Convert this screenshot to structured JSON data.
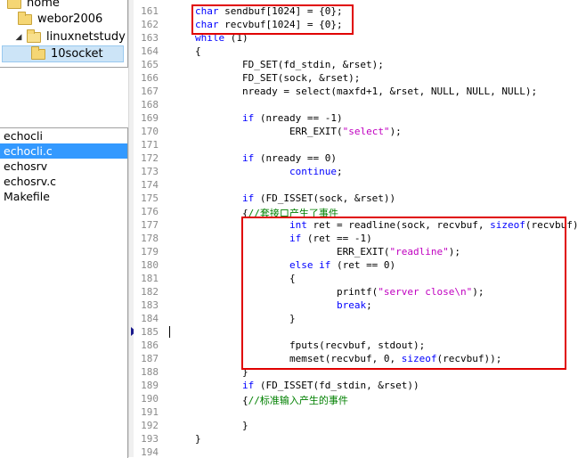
{
  "tree": {
    "items": [
      {
        "label": "home",
        "expander": "",
        "open": false
      },
      {
        "label": "webor2006",
        "expander": "",
        "open": false
      },
      {
        "label": "linuxnetstudy",
        "expander": "◢",
        "open": true
      },
      {
        "label": "10socket",
        "expander": "",
        "open": false
      }
    ]
  },
  "files": [
    "echocli",
    "echocli.c",
    "echosrv",
    "echosrv.c",
    "Makefile"
  ],
  "code_lines": [
    {
      "n": "161",
      "t": [
        [
          "char",
          "kw"
        ],
        [
          " sendbuf[1024] = {0};",
          ""
        ]
      ]
    },
    {
      "n": "162",
      "t": [
        [
          "char",
          "kw"
        ],
        [
          " recvbuf[1024] = {0};",
          ""
        ]
      ]
    },
    {
      "n": "163",
      "t": [
        [
          "while",
          "kw"
        ],
        [
          " (1)",
          ""
        ]
      ]
    },
    {
      "n": "164",
      "t": [
        [
          "{",
          ""
        ]
      ]
    },
    {
      "n": "165",
      "t": [
        [
          "        FD_SET(fd_stdin, &rset);",
          ""
        ]
      ]
    },
    {
      "n": "166",
      "t": [
        [
          "        FD_SET(sock, &rset);",
          ""
        ]
      ]
    },
    {
      "n": "167",
      "t": [
        [
          "        nready = select(maxfd+1, &rset, NULL, NULL, NULL);",
          ""
        ]
      ]
    },
    {
      "n": "168",
      "t": []
    },
    {
      "n": "169",
      "t": [
        [
          "        ",
          ""
        ],
        [
          "if",
          "kw"
        ],
        [
          " (nready == -1)",
          ""
        ]
      ]
    },
    {
      "n": "170",
      "t": [
        [
          "                ERR_EXIT(",
          ""
        ],
        [
          "\"select\"",
          "str"
        ],
        [
          ");",
          ""
        ]
      ]
    },
    {
      "n": "171",
      "t": []
    },
    {
      "n": "172",
      "t": [
        [
          "        ",
          ""
        ],
        [
          "if",
          "kw"
        ],
        [
          " (nready == 0)",
          ""
        ]
      ]
    },
    {
      "n": "173",
      "t": [
        [
          "                ",
          ""
        ],
        [
          "continue",
          "kw"
        ],
        [
          ";",
          ""
        ]
      ]
    },
    {
      "n": "174",
      "t": []
    },
    {
      "n": "175",
      "t": [
        [
          "        ",
          ""
        ],
        [
          "if",
          "kw"
        ],
        [
          " (FD_ISSET(sock, &rset))",
          ""
        ]
      ]
    },
    {
      "n": "176",
      "t": [
        [
          "        {",
          ""
        ],
        [
          "//套接口产生了事件",
          "cm"
        ]
      ]
    },
    {
      "n": "177",
      "t": [
        [
          "                ",
          ""
        ],
        [
          "int",
          "kw"
        ],
        [
          " ret = readline(sock, recvbuf, ",
          ""
        ],
        [
          "sizeof",
          "kw"
        ],
        [
          "(recvbuf));",
          ""
        ]
      ]
    },
    {
      "n": "178",
      "t": [
        [
          "                ",
          ""
        ],
        [
          "if",
          "kw"
        ],
        [
          " (ret == -1)",
          ""
        ]
      ]
    },
    {
      "n": "179",
      "t": [
        [
          "                        ERR_EXIT(",
          ""
        ],
        [
          "\"readline\"",
          "str"
        ],
        [
          ");",
          ""
        ]
      ]
    },
    {
      "n": "180",
      "t": [
        [
          "                ",
          ""
        ],
        [
          "else if",
          "kw"
        ],
        [
          " (ret == 0)",
          ""
        ]
      ]
    },
    {
      "n": "181",
      "t": [
        [
          "                {",
          ""
        ]
      ]
    },
    {
      "n": "182",
      "t": [
        [
          "                        printf(",
          ""
        ],
        [
          "\"server close\\n\"",
          "str"
        ],
        [
          ");",
          ""
        ]
      ]
    },
    {
      "n": "183",
      "t": [
        [
          "                        ",
          ""
        ],
        [
          "break",
          "kw"
        ],
        [
          ";",
          ""
        ]
      ]
    },
    {
      "n": "184",
      "t": [
        [
          "                }",
          ""
        ]
      ]
    },
    {
      "n": "185",
      "t": []
    },
    {
      "n": "186",
      "t": [
        [
          "                fputs(recvbuf, stdout);",
          ""
        ]
      ]
    },
    {
      "n": "187",
      "t": [
        [
          "                memset(recvbuf, 0, ",
          ""
        ],
        [
          "sizeof",
          "kw"
        ],
        [
          "(recvbuf));",
          ""
        ]
      ]
    },
    {
      "n": "188",
      "t": [
        [
          "        }",
          ""
        ]
      ]
    },
    {
      "n": "189",
      "t": [
        [
          "        ",
          ""
        ],
        [
          "if",
          "kw"
        ],
        [
          " (FD_ISSET(fd_stdin, &rset))",
          ""
        ]
      ]
    },
    {
      "n": "190",
      "t": [
        [
          "        {",
          ""
        ],
        [
          "//标准输入产生的事件",
          "cm"
        ]
      ]
    },
    {
      "n": "191",
      "t": []
    },
    {
      "n": "192",
      "t": [
        [
          "        }",
          ""
        ]
      ]
    },
    {
      "n": "193",
      "t": [
        [
          "}",
          ""
        ]
      ]
    },
    {
      "n": "194",
      "t": []
    }
  ],
  "colors": {
    "keyword": "#0000ff",
    "string": "#c000c0",
    "comment": "#008000",
    "highlight_box": "#e00000",
    "selection": "#3399ff"
  }
}
